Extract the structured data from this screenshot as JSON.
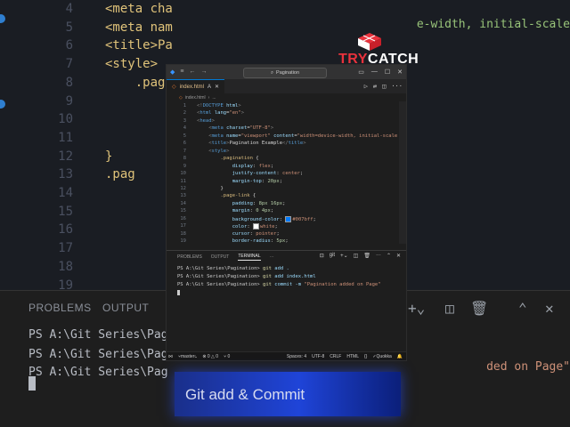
{
  "background": {
    "lines": [
      {
        "num": "4",
        "code": "<meta cha"
      },
      {
        "num": "5",
        "code": "<meta nam"
      },
      {
        "num": "6",
        "code": "<title>Pa"
      },
      {
        "num": "7",
        "code": "<style>"
      },
      {
        "num": "8",
        "code": "    .pagi"
      },
      {
        "num": "9",
        "code": ""
      },
      {
        "num": "10",
        "code": ""
      },
      {
        "num": "11",
        "code": ""
      },
      {
        "num": "12",
        "code": "}"
      },
      {
        "num": "13",
        "code": ".pag"
      },
      {
        "num": "14",
        "code": ""
      },
      {
        "num": "15",
        "code": ""
      },
      {
        "num": "16",
        "code": ""
      },
      {
        "num": "17",
        "code": ""
      },
      {
        "num": "18",
        "code": ""
      },
      {
        "num": "19",
        "code": ""
      }
    ],
    "right_text": "e-width, initial-scale",
    "panel_tabs": {
      "problems": "PROBLEMS",
      "output": "OUTPUT"
    },
    "terminal": [
      "PS A:\\Git Series\\Pagi",
      "PS A:\\Git Series\\Pag",
      "PS A:\\Git Series\\Pag"
    ],
    "terminal_right": "ded on Page\""
  },
  "logo": {
    "try": "TRY",
    "catch": "CATCH"
  },
  "window": {
    "search": "Pagination",
    "tab_label": "index.html",
    "tab_modifier": "A",
    "breadcrumb": [
      "index.html",
      "..."
    ]
  },
  "editor": {
    "lines": [
      {
        "n": "1",
        "html": "<span class='brk'>&lt;!</span><span class='doc'>DOCTYPE</span> <span class='atn'>html</span><span class='brk'>&gt;</span>"
      },
      {
        "n": "2",
        "html": "<span class='brk'>&lt;</span><span class='tag'>html</span> <span class='atn'>lang</span>=<span class='atv'>\"en\"</span><span class='brk'>&gt;</span>"
      },
      {
        "n": "3",
        "html": "<span class='brk'>&lt;</span><span class='tag'>head</span><span class='brk'>&gt;</span>"
      },
      {
        "n": "4",
        "html": "    <span class='brk'>&lt;</span><span class='tag'>meta</span> <span class='atn'>charset</span>=<span class='atv'>\"UTF-8\"</span><span class='brk'>&gt;</span>"
      },
      {
        "n": "5",
        "html": "    <span class='brk'>&lt;</span><span class='tag'>meta</span> <span class='atn'>name</span>=<span class='atv'>\"viewport\"</span> <span class='atn'>content</span>=<span class='atv'>\"width=device-width, initial-scale</span>"
      },
      {
        "n": "6",
        "html": "    <span class='brk'>&lt;</span><span class='tag'>title</span><span class='brk'>&gt;</span>Pagination Example<span class='brk'>&lt;/</span><span class='tag'>title</span><span class='brk'>&gt;</span>"
      },
      {
        "n": "7",
        "html": "    <span class='brk'>&lt;</span><span class='tag'>style</span><span class='brk'>&gt;</span>"
      },
      {
        "n": "8",
        "html": "        <span class='sel'>.pagination</span> {"
      },
      {
        "n": "9",
        "html": "            <span class='prop'>display</span>: <span class='val'>flex</span>;"
      },
      {
        "n": "10",
        "html": "            <span class='prop'>justify-content</span>: <span class='val'>center</span>;"
      },
      {
        "n": "11",
        "html": "            <span class='prop'>margin-top</span>: <span class='num'>20px</span>;"
      },
      {
        "n": "12",
        "html": "        }"
      },
      {
        "n": "13",
        "html": "        <span class='sel'>.page-link</span> {"
      },
      {
        "n": "14",
        "html": "            <span class='prop'>padding</span>: <span class='num'>8px 16px</span>;"
      },
      {
        "n": "15",
        "html": "            <span class='prop'>margin</span>: <span class='num'>0 4px</span>;"
      },
      {
        "n": "16",
        "html": "            <span class='prop'>background-color</span>: <span class='swatch' style='background:#007bff'></span><span class='val'>#007bff</span>;"
      },
      {
        "n": "17",
        "html": "            <span class='prop'>color</span>: <span class='swatch' style='background:#ffffff'></span><span class='val'>white</span>;"
      },
      {
        "n": "18",
        "html": "            <span class='prop'>cursor</span>: <span class='val'>pointer</span>;"
      },
      {
        "n": "19",
        "html": "            <span class='prop'>border-radius</span>: <span class='num'>5px</span>;"
      }
    ]
  },
  "panel": {
    "tabs": {
      "problems": "PROBLEMS",
      "output": "OUTPUT",
      "terminal": "TERMINAL",
      "more": "···"
    },
    "shell_label": "git",
    "terminal": [
      {
        "prompt": "PS A:\\Git Series\\Pagination> ",
        "cmd": "git",
        "args": " add .",
        "str": ""
      },
      {
        "prompt": "PS A:\\Git Series\\Pagination> ",
        "cmd": "git",
        "args": " add index.html",
        "str": ""
      },
      {
        "prompt": "PS A:\\Git Series\\Pagination> ",
        "cmd": "git",
        "args": " commit -m ",
        "str": "\"Pagination added on Page\""
      }
    ]
  },
  "statusbar": {
    "branch": "master",
    "problems": "⊗ 0 △ 0",
    "ports": "⑂ 0",
    "spaces": "Spaces: 4",
    "encoding": "UTF-8",
    "eol": "CRLF",
    "language": "HTML",
    "formatter": "Quokka"
  },
  "caption": {
    "text": "Git add & Commit"
  },
  "colors": {
    "accent": "#0078d4",
    "brand_red": "#e8323c",
    "caption_blue": "#1f44d8"
  }
}
